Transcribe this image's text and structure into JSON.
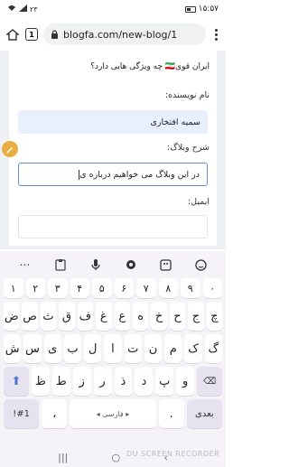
{
  "status": {
    "time": "۱۵:۵۷",
    "signal": "▲▼",
    "extra": "۲۳"
  },
  "browser": {
    "tab_count": "1",
    "url": "blogfa.com/new-blog/1"
  },
  "form": {
    "question_text": "ایران قوی🇮🇷 چه ویژگی هایی دارد؟",
    "author_label": "نام نویسنده:",
    "author_value": "سمیه افتخاری",
    "desc_label": "شرح وبلاگ:",
    "desc_value": "در این وبلاگ می خواهیم درباره ی",
    "email_label": "ایمیل:",
    "email_value": ""
  },
  "keyboard": {
    "tools": [
      "more-icon",
      "clipboard-icon",
      "mic-icon",
      "settings-icon",
      "sticker-icon",
      "emoji-icon"
    ],
    "digits": [
      "۱",
      "۲",
      "۳",
      "۴",
      "۵",
      "۶",
      "۷",
      "۸",
      "۹",
      "۰"
    ],
    "row1": [
      "ض",
      "ص",
      "ث",
      "ق",
      "ف",
      "غ",
      "ع",
      "ه",
      "خ",
      "ح",
      "ج",
      "چ"
    ],
    "row1_hints": [
      "",
      "",
      "",
      "",
      "",
      "",
      "",
      "",
      "",
      "",
      "",
      ""
    ],
    "row2": [
      "ش",
      "س",
      "ی",
      "ب",
      "ل",
      "ا",
      "ت",
      "ن",
      "م",
      "ک",
      "گ"
    ],
    "row3": [
      "ظ",
      "ط",
      "ز",
      "ر",
      "ذ",
      "د",
      "پ",
      "و"
    ],
    "shift_label": "⬆",
    "backspace_label": "⌫",
    "sym_label": "!#1",
    "comma_label": "،",
    "space_label": "◂ فارسی ▸",
    "period_label": ".",
    "enter_label": "بعدی"
  },
  "navbar": {
    "recent": "|||",
    "home": "○",
    "back": "‹"
  },
  "watermark": "DU SCREEN RECORDER"
}
